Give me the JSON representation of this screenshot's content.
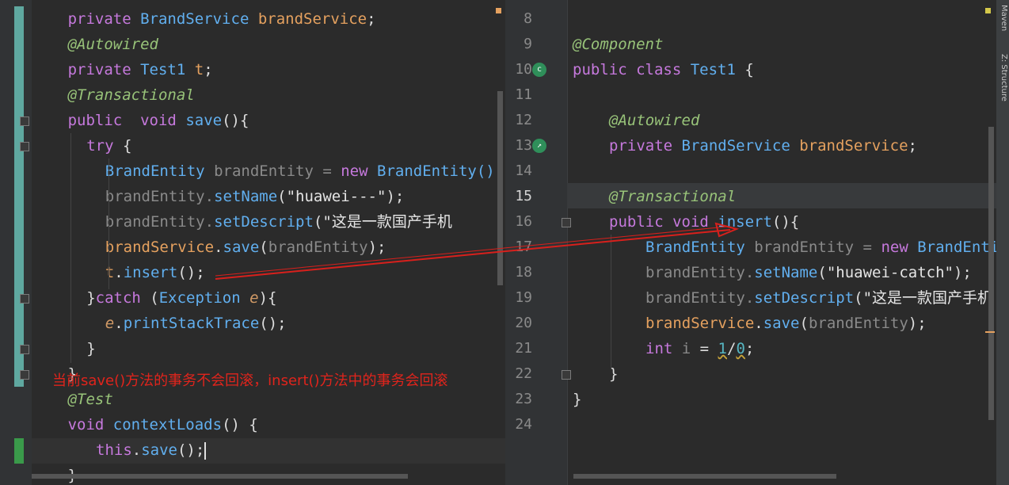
{
  "left_editor": {
    "lines": [
      {
        "indent": 2,
        "tokens": [
          [
            "k",
            "private "
          ],
          [
            "t",
            "BrandService "
          ],
          [
            "v",
            "brandService"
          ],
          [
            "p",
            ";"
          ]
        ]
      },
      {
        "indent": 2,
        "tokens": [
          [
            "a",
            "@Autowired"
          ]
        ]
      },
      {
        "indent": 2,
        "tokens": [
          [
            "k",
            "private "
          ],
          [
            "t",
            "Test1 "
          ],
          [
            "v",
            "t"
          ],
          [
            "p",
            ";"
          ]
        ]
      },
      {
        "indent": 2,
        "tokens": [
          [
            "a",
            "@Transactional"
          ]
        ]
      },
      {
        "indent": 2,
        "tokens": [
          [
            "k",
            "public  void "
          ],
          [
            "n",
            "save"
          ],
          [
            "p",
            "(){"
          ]
        ]
      },
      {
        "indent": 4,
        "tokens": [
          [
            "k",
            "try "
          ],
          [
            "p",
            "{"
          ]
        ]
      },
      {
        "indent": 6,
        "tokens": [
          [
            "t",
            "BrandEntity "
          ],
          [
            "i",
            "brandEntity = "
          ],
          [
            "k",
            "new "
          ],
          [
            "t",
            "BrandEntity();"
          ]
        ]
      },
      {
        "indent": 6,
        "tokens": [
          [
            "i",
            "brandEntity."
          ],
          [
            "n",
            "setName"
          ],
          [
            "p",
            "("
          ],
          [
            "s",
            "\"huawei---\""
          ],
          [
            "p",
            ");"
          ]
        ]
      },
      {
        "indent": 6,
        "tokens": [
          [
            "i",
            "brandEntity."
          ],
          [
            "n",
            "setDescript"
          ],
          [
            "p",
            "("
          ],
          [
            "s",
            "\"这是一款国产手机"
          ]
        ]
      },
      {
        "indent": 6,
        "tokens": [
          [
            "v",
            "brandService"
          ],
          [
            "p",
            "."
          ],
          [
            "n",
            "save"
          ],
          [
            "p",
            "("
          ],
          [
            "i",
            "brandEntity"
          ],
          [
            "p",
            ");"
          ]
        ]
      },
      {
        "indent": 6,
        "tokens": [
          [
            "v",
            "t"
          ],
          [
            "p",
            "."
          ],
          [
            "n",
            "insert"
          ],
          [
            "p",
            "();"
          ]
        ]
      },
      {
        "indent": 4,
        "tokens": [
          [
            "p",
            "}"
          ],
          [
            "k",
            "catch "
          ],
          [
            "p",
            "("
          ],
          [
            "t",
            "Exception "
          ],
          [
            "e",
            "e"
          ],
          [
            "p",
            "){"
          ]
        ]
      },
      {
        "indent": 6,
        "tokens": [
          [
            "e",
            "e"
          ],
          [
            "p",
            "."
          ],
          [
            "n",
            "printStackTrace"
          ],
          [
            "p",
            "();"
          ]
        ]
      },
      {
        "indent": 4,
        "tokens": [
          [
            "p",
            "}"
          ]
        ]
      },
      {
        "indent": 2,
        "tokens": [
          [
            "p",
            "}"
          ]
        ]
      },
      {
        "indent": 2,
        "tokens": [
          [
            "a",
            "@Test"
          ]
        ]
      },
      {
        "indent": 2,
        "tokens": [
          [
            "k",
            "void "
          ],
          [
            "n",
            "contextLoads"
          ],
          [
            "p",
            "() {"
          ]
        ]
      },
      {
        "indent": 5,
        "tokens": [
          [
            "k",
            "this"
          ],
          [
            "p",
            "."
          ],
          [
            "n",
            "save"
          ],
          [
            "p",
            "();"
          ]
        ]
      },
      {
        "indent": 2,
        "tokens": [
          [
            "p",
            "}"
          ]
        ]
      }
    ]
  },
  "right_editor": {
    "lines": [
      {
        "num": "8",
        "indent": 0,
        "tokens": []
      },
      {
        "num": "9",
        "indent": 0,
        "tokens": [
          [
            "a",
            "@Component"
          ]
        ]
      },
      {
        "num": "10",
        "indent": 0,
        "tokens": [
          [
            "k",
            "public class "
          ],
          [
            "t",
            "Test1 "
          ],
          [
            "p",
            "{"
          ]
        ]
      },
      {
        "num": "11",
        "indent": 0,
        "tokens": []
      },
      {
        "num": "12",
        "indent": 4,
        "tokens": [
          [
            "a",
            "@Autowired"
          ]
        ]
      },
      {
        "num": "13",
        "indent": 4,
        "tokens": [
          [
            "k",
            "private "
          ],
          [
            "t",
            "BrandService "
          ],
          [
            "v",
            "brandService"
          ],
          [
            "p",
            ";"
          ]
        ]
      },
      {
        "num": "14",
        "indent": 0,
        "tokens": []
      },
      {
        "num": "15",
        "indent": 4,
        "tokens": [
          [
            "a",
            "@Transactional"
          ]
        ]
      },
      {
        "num": "16",
        "indent": 4,
        "tokens": [
          [
            "k",
            "public void "
          ],
          [
            "n",
            "insert"
          ],
          [
            "p",
            "(){"
          ]
        ]
      },
      {
        "num": "17",
        "indent": 8,
        "tokens": [
          [
            "t",
            "BrandEntity "
          ],
          [
            "i",
            "brandEntity = "
          ],
          [
            "k",
            "new "
          ],
          [
            "t",
            "BrandEntity();"
          ]
        ]
      },
      {
        "num": "18",
        "indent": 8,
        "tokens": [
          [
            "i",
            "brandEntity."
          ],
          [
            "n",
            "setName"
          ],
          [
            "p",
            "("
          ],
          [
            "s",
            "\"huawei-catch\""
          ],
          [
            "p",
            ");"
          ]
        ]
      },
      {
        "num": "19",
        "indent": 8,
        "tokens": [
          [
            "i",
            "brandEntity."
          ],
          [
            "n",
            "setDescript"
          ],
          [
            "p",
            "("
          ],
          [
            "s",
            "\"这是一款国产手机"
          ]
        ]
      },
      {
        "num": "20",
        "indent": 8,
        "tokens": [
          [
            "v",
            "brandService"
          ],
          [
            "p",
            "."
          ],
          [
            "n",
            "save"
          ],
          [
            "p",
            "("
          ],
          [
            "i",
            "brandEntity"
          ],
          [
            "p",
            ");"
          ]
        ]
      },
      {
        "num": "21",
        "indent": 8,
        "tokens": [
          [
            "k",
            "int "
          ],
          [
            "i",
            "i "
          ],
          [
            "p",
            "= "
          ],
          [
            "m",
            "1"
          ],
          [
            "p",
            "/"
          ],
          [
            "m",
            "0"
          ],
          [
            "p",
            ";"
          ]
        ]
      },
      {
        "num": "22",
        "indent": 4,
        "tokens": [
          [
            "p",
            "}"
          ]
        ]
      },
      {
        "num": "23",
        "indent": 0,
        "tokens": [
          [
            "p",
            "}"
          ]
        ]
      },
      {
        "num": "24",
        "indent": 0,
        "tokens": []
      }
    ],
    "current_line": "15",
    "gutter_badges": [
      {
        "line": "10",
        "icon": "spring-bean-icon",
        "glyph": "c"
      },
      {
        "line": "13",
        "icon": "autowired-bean-icon",
        "glyph": "↗"
      }
    ]
  },
  "annotation": "当前save()方法的事务不会回滚，insert()方法中的事务会回滚",
  "side_tabs": {
    "maven": "Maven",
    "structure": "Z: Structure"
  },
  "colors": {
    "annotation": "#e0241c",
    "arrow": "#d8201c"
  }
}
